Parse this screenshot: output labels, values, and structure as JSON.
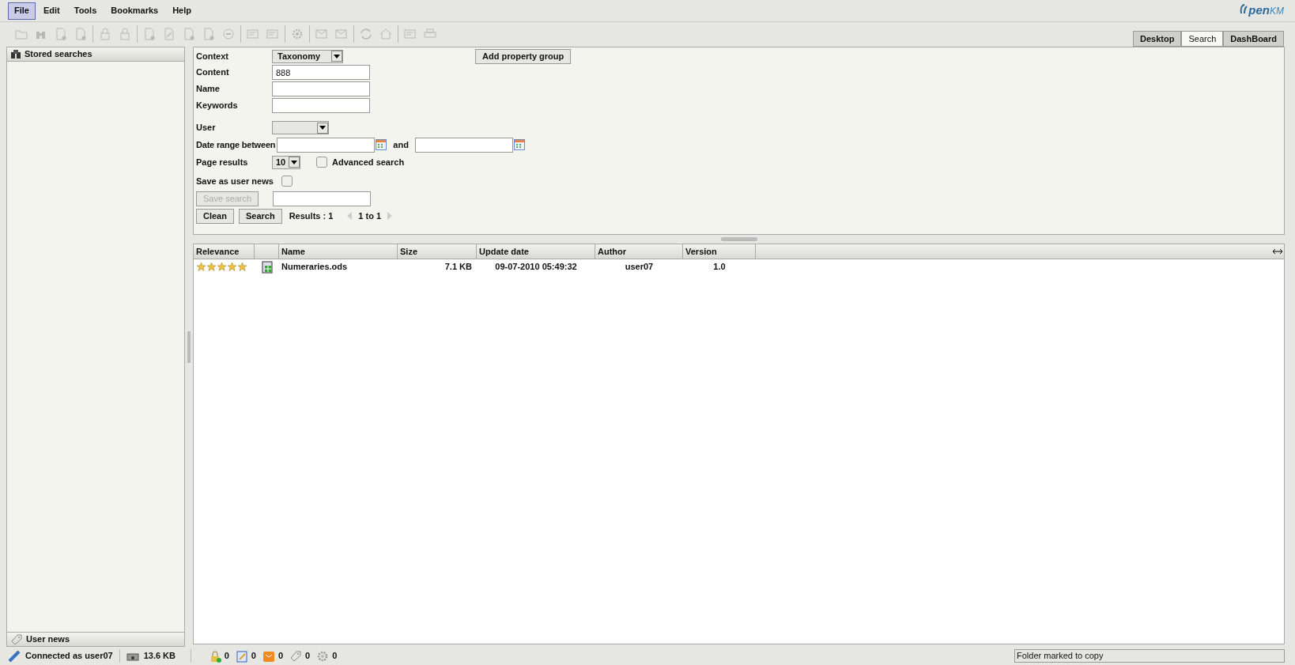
{
  "menu": [
    {
      "label": "File",
      "selected": true
    },
    {
      "label": "Edit",
      "selected": false
    },
    {
      "label": "Tools",
      "selected": false
    },
    {
      "label": "Bookmarks",
      "selected": false
    },
    {
      "label": "Help",
      "selected": false
    }
  ],
  "logo": {
    "text": "pen",
    "suffix": "KM"
  },
  "toolbar": [
    [
      {
        "kind": "folder",
        "disabled": true
      },
      {
        "kind": "binoculars",
        "disabled": true
      },
      {
        "kind": "document",
        "disabled": true
      },
      {
        "kind": "document",
        "disabled": true
      }
    ],
    [
      {
        "kind": "lock",
        "disabled": true
      },
      {
        "kind": "lock",
        "disabled": true
      }
    ],
    [
      {
        "kind": "document",
        "disabled": true
      },
      {
        "kind": "pencil",
        "disabled": true
      },
      {
        "kind": "document",
        "disabled": true
      },
      {
        "kind": "document",
        "disabled": true
      },
      {
        "kind": "minus",
        "disabled": true
      }
    ],
    [
      {
        "kind": "card",
        "disabled": true
      },
      {
        "kind": "card",
        "disabled": true
      }
    ],
    [
      {
        "kind": "gear",
        "disabled": true
      }
    ],
    [
      {
        "kind": "mail",
        "disabled": true
      },
      {
        "kind": "mail",
        "disabled": true
      }
    ],
    [
      {
        "kind": "refresh",
        "disabled": true
      },
      {
        "kind": "home",
        "disabled": true
      }
    ],
    [
      {
        "kind": "card",
        "disabled": true
      },
      {
        "kind": "printer",
        "disabled": true
      }
    ]
  ],
  "tabs": [
    {
      "label": "Desktop",
      "selected": false
    },
    {
      "label": "Search",
      "selected": true
    },
    {
      "label": "DashBoard",
      "selected": false
    }
  ],
  "sidebar": {
    "title": "Stored searches",
    "footer": "User news"
  },
  "form": {
    "context_label": "Context",
    "context_value": "Taxonomy",
    "add_property_group": "Add property group",
    "content_label": "Content",
    "content_value": "888",
    "name_label": "Name",
    "keywords_label": "Keywords",
    "user_label": "User",
    "date_label": "Date range between",
    "and_label": "and",
    "page_results_label": "Page results",
    "page_results_value": "10",
    "advanced_search": {
      "label": "Advanced search",
      "checked": false
    },
    "save_news": {
      "label": "Save as user news",
      "checked": false
    },
    "save_search": {
      "label": "Save search",
      "disabled": true
    },
    "clean": "Clean",
    "search": "Search",
    "results": "Results : 1",
    "range": "1 to 1"
  },
  "table": {
    "columns": [
      "Relevance",
      "",
      "Name",
      "Size",
      "Update date",
      "Author",
      "Version"
    ],
    "rows": [
      {
        "stars": 5,
        "name": "Numeraries.ods",
        "size": "7.1 KB",
        "updated": "09-07-2010 05:49:32",
        "author": "user07",
        "version": "1.0"
      }
    ]
  },
  "status_bar": {
    "connected": "Connected as user07",
    "size": "13.6 KB",
    "counts": [
      {
        "kind": "lock",
        "value": "0"
      },
      {
        "kind": "edit",
        "value": "0"
      },
      {
        "kind": "mail",
        "value": "0"
      },
      {
        "kind": "tag",
        "value": "0"
      },
      {
        "kind": "gear",
        "value": "0"
      }
    ],
    "message": "Folder marked to copy"
  }
}
